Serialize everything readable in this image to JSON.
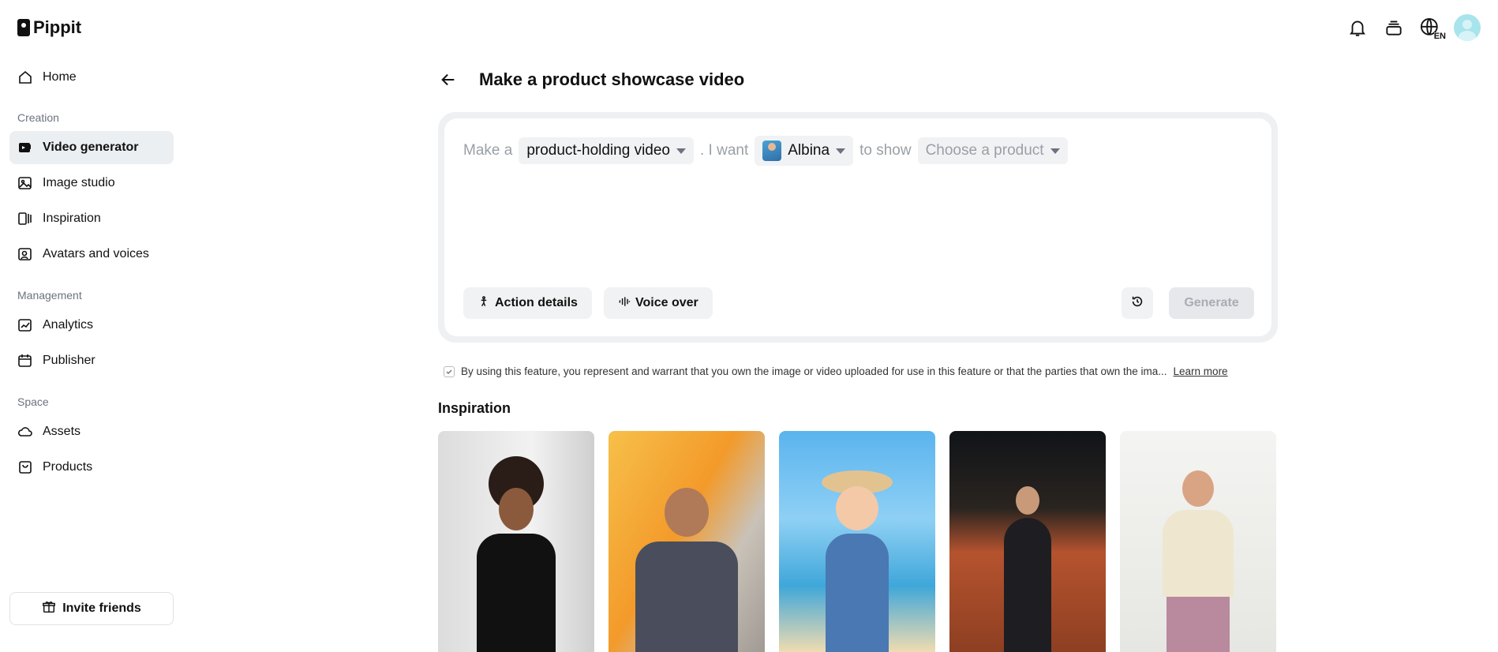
{
  "app": {
    "name": "Pippit"
  },
  "sidebar": {
    "home": "Home",
    "sections": {
      "creation": "Creation",
      "management": "Management",
      "space": "Space"
    },
    "creation_items": [
      "Video generator",
      "Image studio",
      "Inspiration",
      "Avatars and voices"
    ],
    "management_items": [
      "Analytics",
      "Publisher"
    ],
    "space_items": [
      "Assets",
      "Products"
    ],
    "active_item": "Video generator",
    "invite": "Invite friends"
  },
  "header": {
    "title": "Make a product showcase video",
    "language": "EN"
  },
  "composer": {
    "prefix": "Make a",
    "video_type": "product-holding video",
    "mid": ". I want",
    "avatar_name": "Albina",
    "suffix": "to show",
    "product_placeholder": "Choose a product",
    "action_details": "Action details",
    "voice_over": "Voice over",
    "generate": "Generate"
  },
  "disclaimer": {
    "text": "By using this feature, you represent and warrant that you own the image or video uploaded for use in this feature or that the parties that own the ima...",
    "link": "Learn more"
  },
  "inspiration": {
    "title": "Inspiration"
  },
  "colors": {
    "active_bg": "#eceff2",
    "button_bg": "#f1f2f4",
    "disabled_text": "#a9adb3"
  }
}
